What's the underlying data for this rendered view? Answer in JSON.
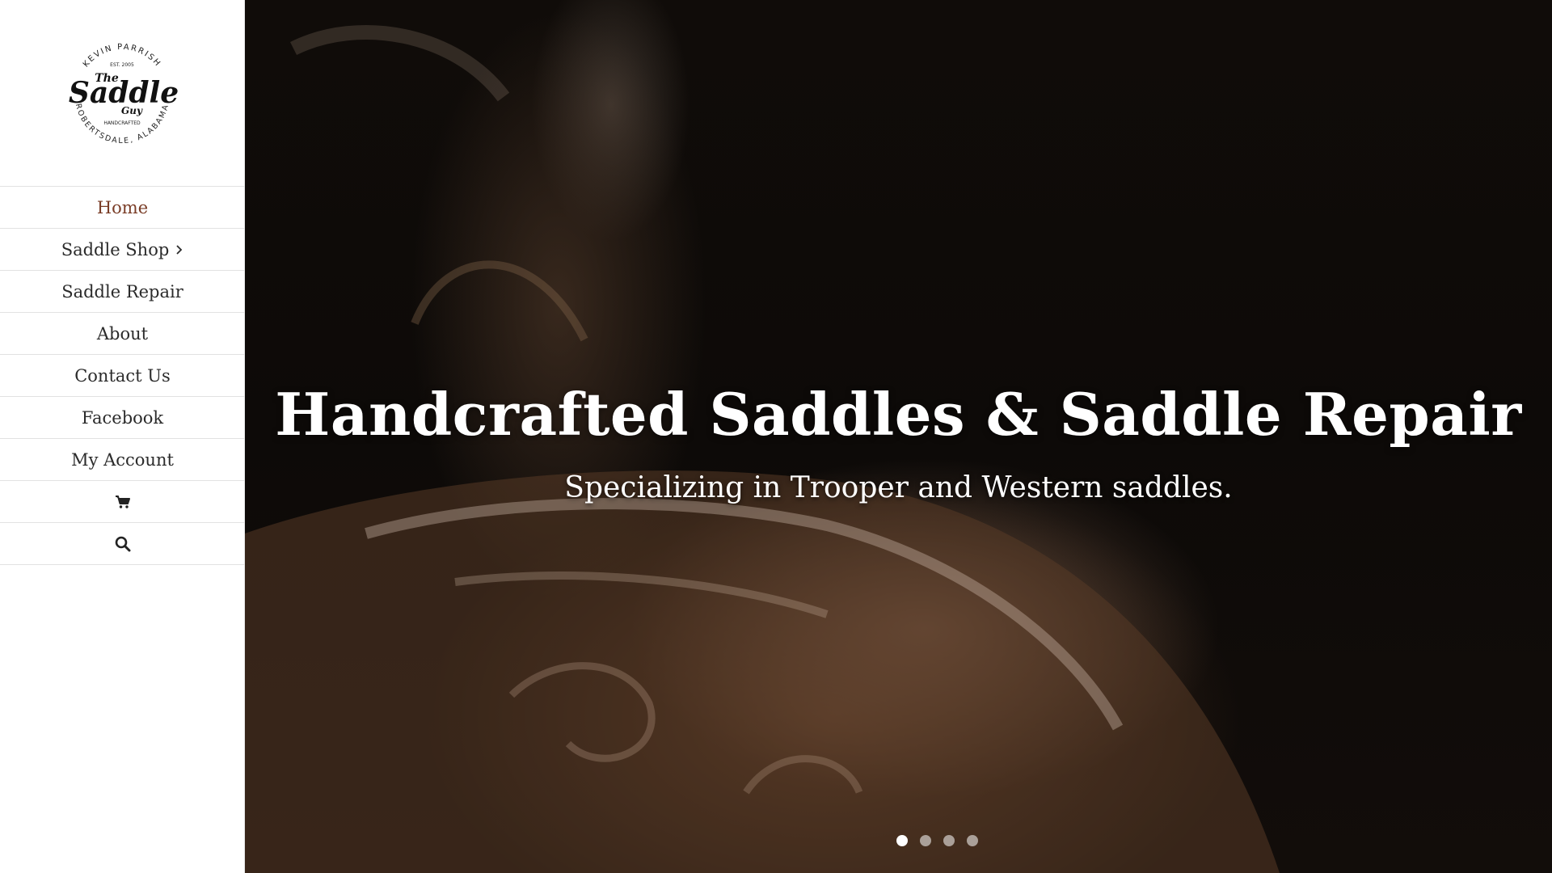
{
  "logo": {
    "top_arc": "KEVIN PARRISH",
    "est": "EST. 2005",
    "the": "The",
    "name": "Saddle",
    "guy": "Guy",
    "handcrafted": "HANDCRAFTED",
    "bottom_arc": "ROBERTSDALE, ALABAMA"
  },
  "nav": {
    "items": [
      {
        "label": "Home",
        "active": true
      },
      {
        "label": "Saddle Shop",
        "has_submenu": true
      },
      {
        "label": "Saddle Repair"
      },
      {
        "label": "About"
      },
      {
        "label": "Contact Us"
      },
      {
        "label": "Facebook"
      },
      {
        "label": "My Account"
      }
    ],
    "cart_icon": "shopping-cart-icon",
    "search_icon": "search-icon",
    "active_color": "#7a3d27"
  },
  "hero": {
    "title": "Handcrafted Saddles & Saddle Repair",
    "subtitle": "Specializing in Trooper and Western saddles.",
    "slide_count": 4,
    "active_slide": 1
  }
}
